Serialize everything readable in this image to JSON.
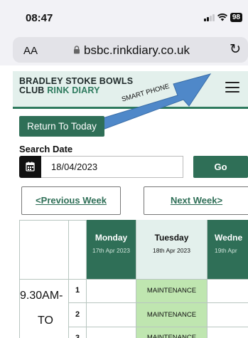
{
  "status_bar": {
    "time": "08:47",
    "battery": "98"
  },
  "browser": {
    "text_size_label": "AA",
    "url": "bsbc.rinkdiary.co.uk",
    "reload_glyph": "↻"
  },
  "site": {
    "brand_line1": "BRADLEY STOKE BOWLS",
    "brand_line2_prefix": "CLUB ",
    "brand_line2_green": "RINK DIARY"
  },
  "annotation": {
    "label": "SMART PHONE"
  },
  "controls": {
    "return_label": "Return To Today",
    "search_label": "Search Date",
    "date_value": "18/04/2023",
    "go_label": "Go",
    "prev_week_label": "<Previous Week",
    "next_week_label": "Next Week>"
  },
  "colors": {
    "brand_green": "#2f6f57",
    "header_bg": "#e3f0ec",
    "maintenance": "#bfe6b0"
  },
  "table": {
    "days": [
      {
        "name": "Monday",
        "date": "17th Apr 2023"
      },
      {
        "name": "Tuesday",
        "date": "18th Apr 2023"
      },
      {
        "name": "Wedne",
        "date": "19th Apr"
      }
    ],
    "time_slot": {
      "line1": "9.30AM-",
      "line2": "TO"
    },
    "rows": [
      {
        "rink": "1",
        "tuesday": "MAINTENANCE"
      },
      {
        "rink": "2",
        "tuesday": "MAINTENANCE"
      },
      {
        "rink": "3",
        "tuesday": "MAINTENANCE"
      }
    ]
  }
}
